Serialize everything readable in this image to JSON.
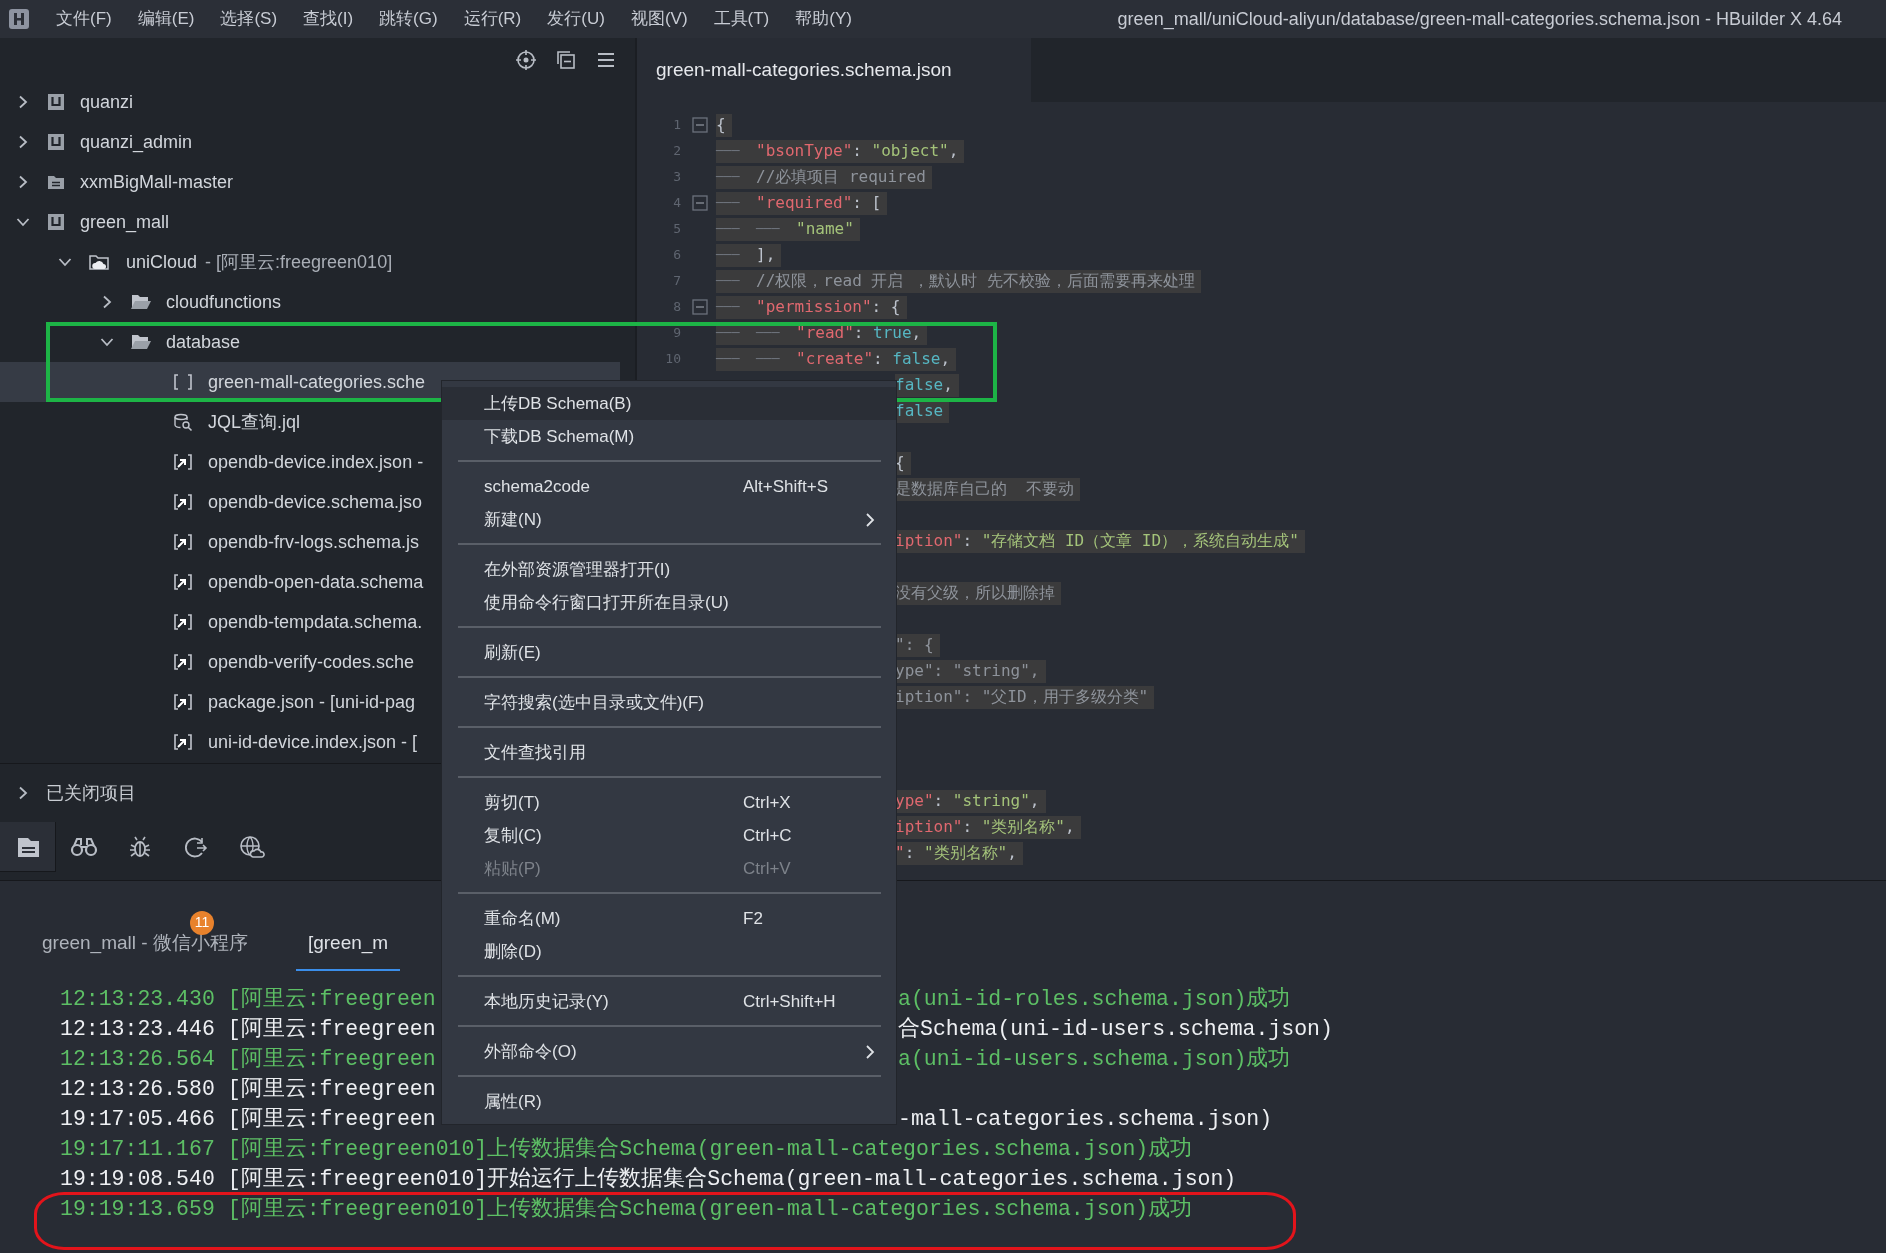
{
  "window": {
    "title": "green_mall/uniCloud-aliyun/database/green-mall-categories.schema.json - HBuilder X 4.64"
  },
  "menubar": [
    "文件(F)",
    "编辑(E)",
    "选择(S)",
    "查找(I)",
    "跳转(G)",
    "运行(R)",
    "发行(U)",
    "视图(V)",
    "工具(T)",
    "帮助(Y)"
  ],
  "tree": [
    {
      "label": "quanzi",
      "kind": "project",
      "expanded": false,
      "selected": false
    },
    {
      "label": "quanzi_admin",
      "kind": "project",
      "expanded": false,
      "selected": false
    },
    {
      "label": "xxmBigMall-master",
      "kind": "folder-project",
      "expanded": false,
      "selected": false
    },
    {
      "label": "green_mall",
      "kind": "project",
      "expanded": true,
      "selected": false,
      "children": [
        {
          "label": "uniCloud",
          "note": "- [阿里云:freegreen010]",
          "kind": "cloud-folder",
          "expanded": true,
          "selected": false,
          "children": [
            {
              "label": "cloudfunctions",
              "kind": "folder",
              "expanded": false,
              "selected": false
            },
            {
              "label": "database",
              "kind": "folder",
              "expanded": true,
              "selected": false,
              "children": [
                {
                  "label": "green-mall-categories.sche",
                  "kind": "schema",
                  "selected": true
                },
                {
                  "label": "JQL查询.jql",
                  "kind": "query",
                  "selected": false
                },
                {
                  "label": "opendb-device.index.json -",
                  "kind": "json",
                  "selected": false
                },
                {
                  "label": "opendb-device.schema.jso",
                  "kind": "json",
                  "selected": false
                },
                {
                  "label": "opendb-frv-logs.schema.js",
                  "kind": "json",
                  "selected": false
                },
                {
                  "label": "opendb-open-data.schema",
                  "kind": "json",
                  "selected": false
                },
                {
                  "label": "opendb-tempdata.schema.",
                  "kind": "json",
                  "selected": false
                },
                {
                  "label": "opendb-verify-codes.sche",
                  "kind": "json",
                  "selected": false
                },
                {
                  "label": "package.json - [uni-id-pag",
                  "kind": "json",
                  "selected": false
                },
                {
                  "label": "uni-id-device.index.json - [",
                  "kind": "json",
                  "selected": false
                }
              ]
            }
          ]
        }
      ]
    }
  ],
  "closed_projects": {
    "label": "已关闭项目",
    "expanded": false
  },
  "side_tools": [
    {
      "kind": "files",
      "selected": true
    },
    {
      "kind": "search",
      "selected": false
    },
    {
      "kind": "debug",
      "selected": false
    },
    {
      "kind": "refresh",
      "selected": false
    },
    {
      "kind": "cloud",
      "selected": false
    }
  ],
  "editor": {
    "tabs": [
      {
        "label": "green-mall-categories.schema.json",
        "selected": true
      }
    ],
    "lines": [
      {
        "kind": "line",
        "num": "1",
        "fold": true,
        "tokens": [
          {
            "kind": "punct",
            "text": "{"
          }
        ]
      },
      {
        "kind": "line",
        "num": "2",
        "fold": false,
        "indent": [
          "───"
        ],
        "tokens": [
          {
            "kind": "key",
            "text": "\"bsonType\""
          },
          {
            "kind": "punct",
            "text": ": "
          },
          {
            "kind": "string",
            "text": "\"object\""
          },
          {
            "kind": "punct",
            "text": ","
          }
        ]
      },
      {
        "kind": "line",
        "num": "3",
        "fold": false,
        "indent": [
          "───"
        ],
        "tokens": [
          {
            "kind": "comment",
            "text": "//必填项目 required"
          }
        ]
      },
      {
        "kind": "line",
        "num": "4",
        "fold": true,
        "indent": [
          "───"
        ],
        "tokens": [
          {
            "kind": "key",
            "text": "\"required\""
          },
          {
            "kind": "punct",
            "text": ": ["
          }
        ]
      },
      {
        "kind": "line",
        "num": "5",
        "fold": false,
        "indent": [
          "───",
          "───"
        ],
        "tokens": [
          {
            "kind": "string",
            "text": "\"name\""
          }
        ]
      },
      {
        "kind": "line",
        "num": "6",
        "fold": false,
        "indent": [
          "───"
        ],
        "tokens": [
          {
            "kind": "punct",
            "text": "],"
          }
        ]
      },
      {
        "kind": "line",
        "num": "7",
        "fold": false,
        "indent": [
          "───"
        ],
        "tokens": [
          {
            "kind": "comment",
            "text": "//权限，read 开启 ，默认时 先不校验，后面需要再来处理"
          }
        ]
      },
      {
        "kind": "line",
        "num": "8",
        "fold": true,
        "indent": [
          "───"
        ],
        "tokens": [
          {
            "kind": "key",
            "text": "\"permission\""
          },
          {
            "kind": "punct",
            "text": ": {"
          }
        ]
      },
      {
        "kind": "line",
        "num": "9",
        "fold": false,
        "indent": [
          "───",
          "───"
        ],
        "tokens": [
          {
            "kind": "key",
            "text": "\"read\""
          },
          {
            "kind": "punct",
            "text": ": "
          },
          {
            "kind": "bool",
            "text": "true"
          },
          {
            "kind": "punct",
            "text": ","
          }
        ]
      },
      {
        "kind": "line",
        "num": "10",
        "fold": false,
        "indent": [
          "───",
          "───"
        ],
        "tokens": [
          {
            "kind": "key",
            "text": "\"create\""
          },
          {
            "kind": "punct",
            "text": ": "
          },
          {
            "kind": "bool",
            "text": "false"
          },
          {
            "kind": "punct",
            "text": ","
          }
        ]
      },
      {
        "kind": "fragment",
        "tokens": [
          {
            "kind": "bool",
            "text": "false"
          },
          {
            "kind": "punct",
            "text": ","
          }
        ]
      },
      {
        "kind": "fragment",
        "tokens": [
          {
            "kind": "bool",
            "text": "false"
          }
        ]
      },
      {
        "kind": "hidden"
      },
      {
        "kind": "fragment",
        "tokens": [
          {
            "kind": "punct",
            "text": "{"
          }
        ]
      },
      {
        "kind": "fragment",
        "tokens": [
          {
            "kind": "comment",
            "text": "是数据库自己的  不要动"
          }
        ]
      },
      {
        "kind": "hidden"
      },
      {
        "kind": "fragment",
        "tokens": [
          {
            "kind": "key",
            "text": "iption\""
          },
          {
            "kind": "punct",
            "text": ": "
          },
          {
            "kind": "string",
            "text": "\"存储文档 ID（文章 ID），系统自动生成\""
          }
        ]
      },
      {
        "kind": "hidden"
      },
      {
        "kind": "fragment",
        "tokens": [
          {
            "kind": "comment",
            "text": "没有父级，所以删除掉"
          }
        ]
      },
      {
        "kind": "hidden"
      },
      {
        "kind": "fragment",
        "tokens": [
          {
            "kind": "comment",
            "text": "\": {"
          }
        ]
      },
      {
        "kind": "fragment",
        "tokens": [
          {
            "kind": "comment",
            "text": "ype\": \"string\","
          }
        ]
      },
      {
        "kind": "fragment",
        "tokens": [
          {
            "kind": "comment",
            "text": "iption\": \"父ID，用于多级分类\""
          }
        ]
      },
      {
        "kind": "hidden"
      },
      {
        "kind": "hidden"
      },
      {
        "kind": "hidden"
      },
      {
        "kind": "fragment",
        "tokens": [
          {
            "kind": "key",
            "text": "ype\""
          },
          {
            "kind": "punct",
            "text": ": "
          },
          {
            "kind": "string",
            "text": "\"string\""
          },
          {
            "kind": "punct",
            "text": ","
          }
        ]
      },
      {
        "kind": "fragment",
        "tokens": [
          {
            "kind": "key",
            "text": "iption\""
          },
          {
            "kind": "punct",
            "text": ": "
          },
          {
            "kind": "string",
            "text": "\"类别名称\""
          },
          {
            "kind": "punct",
            "text": ","
          }
        ]
      },
      {
        "kind": "fragment",
        "tokens": [
          {
            "kind": "key",
            "text": "\""
          },
          {
            "kind": "punct",
            "text": ": "
          },
          {
            "kind": "string",
            "text": "\"类别名称\""
          },
          {
            "kind": "punct",
            "text": ","
          }
        ]
      }
    ]
  },
  "console": {
    "tabs": [
      {
        "label": "green_mall - 微信小程序",
        "badge": "11",
        "selected": false
      },
      {
        "label": "[green_m",
        "selected": true
      }
    ],
    "lines": [
      {
        "kind": "success",
        "left": "12:13:23.430 [阿里云:freegreen",
        "right": "a(uni-id-roles.schema.json)成功"
      },
      {
        "kind": "info",
        "left": "12:13:23.446 [阿里云:freegreen",
        "right": "合Schema(uni-id-users.schema.json)"
      },
      {
        "kind": "success",
        "left": "12:13:26.564 [阿里云:freegreen",
        "right": "a(uni-id-users.schema.json)成功"
      },
      {
        "kind": "info",
        "left": "12:13:26.580 [阿里云:freegreen"
      },
      {
        "kind": "info",
        "left": "19:17:05.466 [阿里云:freegreen",
        "right": "-mall-categories.schema.json)"
      },
      {
        "kind": "success",
        "left": "19:17:11.167 [阿里云:freegreen010]上传数据集合Schema(green-mall-categories.schema.json)成功"
      },
      {
        "kind": "info",
        "left": "19:19:08.540 [阿里云:freegreen010]开始运行上传数据集合Schema(green-mall-categories.schema.json)"
      },
      {
        "kind": "success",
        "left": "19:19:13.659 [阿里云:freegreen010]上传数据集合Schema(green-mall-categories.schema.json)成功"
      }
    ]
  },
  "context_menu": {
    "groups": [
      [
        {
          "label": "上传DB Schema(B)",
          "selected": true,
          "disabled": false
        },
        {
          "label": "下载DB Schema(M)",
          "selected": false,
          "disabled": false
        }
      ],
      [
        {
          "label": "schema2code",
          "shortcut": "Alt+Shift+S",
          "selected": false,
          "disabled": false
        },
        {
          "label": "新建(N)",
          "submenu": true,
          "selected": false,
          "disabled": false
        }
      ],
      [
        {
          "label": "在外部资源管理器打开(I)",
          "selected": false,
          "disabled": false
        },
        {
          "label": "使用命令行窗口打开所在目录(U)",
          "selected": false,
          "disabled": false
        }
      ],
      [
        {
          "label": "刷新(E)",
          "selected": false,
          "disabled": false
        }
      ],
      [
        {
          "label": "字符搜索(选中目录或文件)(F)",
          "selected": false,
          "disabled": false
        }
      ],
      [
        {
          "label": "文件查找引用",
          "selected": false,
          "disabled": false
        }
      ],
      [
        {
          "label": "剪切(T)",
          "shortcut": "Ctrl+X",
          "selected": false,
          "disabled": false
        },
        {
          "label": "复制(C)",
          "shortcut": "Ctrl+C",
          "selected": false,
          "disabled": false
        },
        {
          "label": "粘贴(P)",
          "shortcut": "Ctrl+V",
          "selected": false,
          "disabled": true
        }
      ],
      [
        {
          "label": "重命名(M)",
          "shortcut": "F2",
          "selected": false,
          "disabled": false
        },
        {
          "label": "删除(D)",
          "selected": false,
          "disabled": false
        }
      ],
      [
        {
          "label": "本地历史记录(Y)",
          "shortcut": "Ctrl+Shift+H",
          "selected": false,
          "disabled": false
        }
      ],
      [
        {
          "label": "外部命令(O)",
          "submenu": true,
          "selected": false,
          "disabled": false
        }
      ],
      [
        {
          "label": "属性(R)",
          "selected": false,
          "disabled": false
        }
      ]
    ]
  },
  "annotations": [
    {
      "kind": "rectangle",
      "color": "#1db446"
    },
    {
      "kind": "ellipse",
      "color": "#e3141b"
    }
  ]
}
